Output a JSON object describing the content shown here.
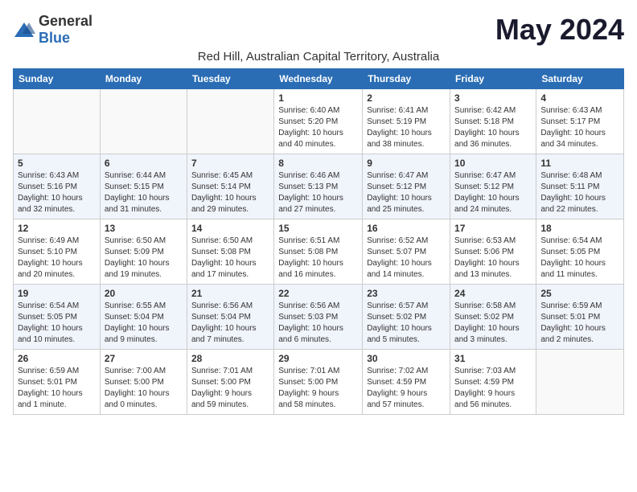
{
  "logo": {
    "general": "General",
    "blue": "Blue"
  },
  "header": {
    "month_year": "May 2024",
    "location": "Red Hill, Australian Capital Territory, Australia"
  },
  "weekdays": [
    "Sunday",
    "Monday",
    "Tuesday",
    "Wednesday",
    "Thursday",
    "Friday",
    "Saturday"
  ],
  "weeks": [
    {
      "days": [
        {
          "number": "",
          "info": ""
        },
        {
          "number": "",
          "info": ""
        },
        {
          "number": "",
          "info": ""
        },
        {
          "number": "1",
          "info": "Sunrise: 6:40 AM\nSunset: 5:20 PM\nDaylight: 10 hours\nand 40 minutes."
        },
        {
          "number": "2",
          "info": "Sunrise: 6:41 AM\nSunset: 5:19 PM\nDaylight: 10 hours\nand 38 minutes."
        },
        {
          "number": "3",
          "info": "Sunrise: 6:42 AM\nSunset: 5:18 PM\nDaylight: 10 hours\nand 36 minutes."
        },
        {
          "number": "4",
          "info": "Sunrise: 6:43 AM\nSunset: 5:17 PM\nDaylight: 10 hours\nand 34 minutes."
        }
      ]
    },
    {
      "days": [
        {
          "number": "5",
          "info": "Sunrise: 6:43 AM\nSunset: 5:16 PM\nDaylight: 10 hours\nand 32 minutes."
        },
        {
          "number": "6",
          "info": "Sunrise: 6:44 AM\nSunset: 5:15 PM\nDaylight: 10 hours\nand 31 minutes."
        },
        {
          "number": "7",
          "info": "Sunrise: 6:45 AM\nSunset: 5:14 PM\nDaylight: 10 hours\nand 29 minutes."
        },
        {
          "number": "8",
          "info": "Sunrise: 6:46 AM\nSunset: 5:13 PM\nDaylight: 10 hours\nand 27 minutes."
        },
        {
          "number": "9",
          "info": "Sunrise: 6:47 AM\nSunset: 5:12 PM\nDaylight: 10 hours\nand 25 minutes."
        },
        {
          "number": "10",
          "info": "Sunrise: 6:47 AM\nSunset: 5:12 PM\nDaylight: 10 hours\nand 24 minutes."
        },
        {
          "number": "11",
          "info": "Sunrise: 6:48 AM\nSunset: 5:11 PM\nDaylight: 10 hours\nand 22 minutes."
        }
      ]
    },
    {
      "days": [
        {
          "number": "12",
          "info": "Sunrise: 6:49 AM\nSunset: 5:10 PM\nDaylight: 10 hours\nand 20 minutes."
        },
        {
          "number": "13",
          "info": "Sunrise: 6:50 AM\nSunset: 5:09 PM\nDaylight: 10 hours\nand 19 minutes."
        },
        {
          "number": "14",
          "info": "Sunrise: 6:50 AM\nSunset: 5:08 PM\nDaylight: 10 hours\nand 17 minutes."
        },
        {
          "number": "15",
          "info": "Sunrise: 6:51 AM\nSunset: 5:08 PM\nDaylight: 10 hours\nand 16 minutes."
        },
        {
          "number": "16",
          "info": "Sunrise: 6:52 AM\nSunset: 5:07 PM\nDaylight: 10 hours\nand 14 minutes."
        },
        {
          "number": "17",
          "info": "Sunrise: 6:53 AM\nSunset: 5:06 PM\nDaylight: 10 hours\nand 13 minutes."
        },
        {
          "number": "18",
          "info": "Sunrise: 6:54 AM\nSunset: 5:05 PM\nDaylight: 10 hours\nand 11 minutes."
        }
      ]
    },
    {
      "days": [
        {
          "number": "19",
          "info": "Sunrise: 6:54 AM\nSunset: 5:05 PM\nDaylight: 10 hours\nand 10 minutes."
        },
        {
          "number": "20",
          "info": "Sunrise: 6:55 AM\nSunset: 5:04 PM\nDaylight: 10 hours\nand 9 minutes."
        },
        {
          "number": "21",
          "info": "Sunrise: 6:56 AM\nSunset: 5:04 PM\nDaylight: 10 hours\nand 7 minutes."
        },
        {
          "number": "22",
          "info": "Sunrise: 6:56 AM\nSunset: 5:03 PM\nDaylight: 10 hours\nand 6 minutes."
        },
        {
          "number": "23",
          "info": "Sunrise: 6:57 AM\nSunset: 5:02 PM\nDaylight: 10 hours\nand 5 minutes."
        },
        {
          "number": "24",
          "info": "Sunrise: 6:58 AM\nSunset: 5:02 PM\nDaylight: 10 hours\nand 3 minutes."
        },
        {
          "number": "25",
          "info": "Sunrise: 6:59 AM\nSunset: 5:01 PM\nDaylight: 10 hours\nand 2 minutes."
        }
      ]
    },
    {
      "days": [
        {
          "number": "26",
          "info": "Sunrise: 6:59 AM\nSunset: 5:01 PM\nDaylight: 10 hours\nand 1 minute."
        },
        {
          "number": "27",
          "info": "Sunrise: 7:00 AM\nSunset: 5:00 PM\nDaylight: 10 hours\nand 0 minutes."
        },
        {
          "number": "28",
          "info": "Sunrise: 7:01 AM\nSunset: 5:00 PM\nDaylight: 9 hours\nand 59 minutes."
        },
        {
          "number": "29",
          "info": "Sunrise: 7:01 AM\nSunset: 5:00 PM\nDaylight: 9 hours\nand 58 minutes."
        },
        {
          "number": "30",
          "info": "Sunrise: 7:02 AM\nSunset: 4:59 PM\nDaylight: 9 hours\nand 57 minutes."
        },
        {
          "number": "31",
          "info": "Sunrise: 7:03 AM\nSunset: 4:59 PM\nDaylight: 9 hours\nand 56 minutes."
        },
        {
          "number": "",
          "info": ""
        }
      ]
    }
  ]
}
